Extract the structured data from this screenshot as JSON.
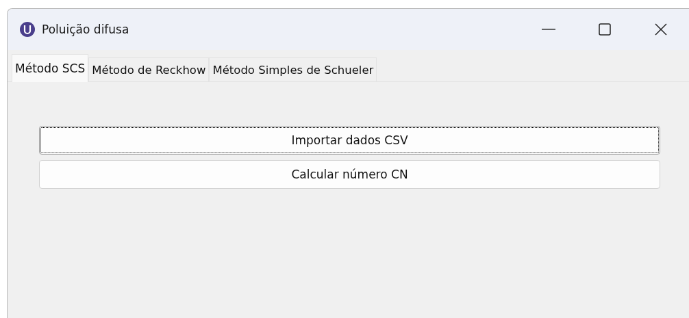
{
  "window": {
    "title": "Poluição difusa"
  },
  "tabs": [
    {
      "label": "Método SCS",
      "selected": true
    },
    {
      "label": "Método de Reckhow",
      "selected": false
    },
    {
      "label": "Método Simples de Schueler",
      "selected": false
    }
  ],
  "buttons": [
    {
      "label": "Importar dados CSV",
      "focused": true
    },
    {
      "label": "Calcular número CN",
      "focused": false
    }
  ]
}
